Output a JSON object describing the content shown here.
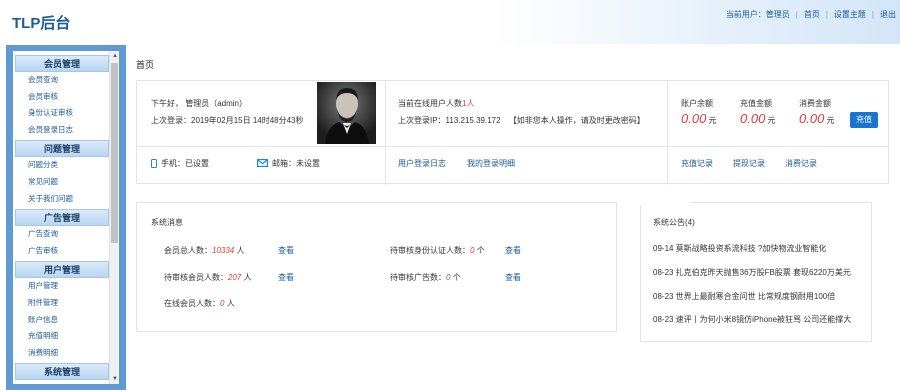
{
  "header": {
    "brand": "TLP后台",
    "current_user_label": "当前用户：管理员",
    "links": [
      "首页",
      "设置主题",
      "退出"
    ]
  },
  "sidebar": {
    "groups": [
      {
        "title": "会员管理",
        "items": [
          "会员查询",
          "会员审核",
          "身份认证审核",
          "会员登录日志"
        ]
      },
      {
        "title": "问题管理",
        "items": [
          "问题分类",
          "常见问题",
          "关于我们问题"
        ]
      },
      {
        "title": "广告管理",
        "items": [
          "广告查询",
          "广告审核"
        ]
      },
      {
        "title": "用户管理",
        "items": [
          "用户管理",
          "附件管理",
          "账户信息",
          "充值明细",
          "消费明细"
        ]
      },
      {
        "title": "系统管理",
        "items": []
      }
    ]
  },
  "breadcrumb": "首页",
  "profile": {
    "greeting": "下午好， 管理员（admin）",
    "last_login": "上次登录：2019年02月15日 14时48分43秒",
    "phone": "手机：已设置",
    "email": "邮箱：未设置"
  },
  "online": {
    "label": "当前在线用户人数",
    "count": "1人",
    "last_ip_label": "上次登录IP：113.215.39.172",
    "warning": "【如非您本人操作，请及时更改密码】",
    "link1": "用户登录日志",
    "link2": "我的登录明细"
  },
  "account": {
    "balance_label": "账户余额",
    "recharge_label": "充值金额",
    "consume_label": "消费金额",
    "balance": "0.00",
    "recharge": "0.00",
    "consume": "0.00",
    "unit": "元",
    "charge_button": "充值",
    "links": [
      "充值记录",
      "提现记录",
      "消费记录"
    ]
  },
  "system_msg": {
    "title": "系统消息",
    "members_total_label": "会员总人数：",
    "members_total": "10334",
    "members_pending_label": "待审核会员人数：",
    "members_pending": "207",
    "online_label": "在线会员人数：",
    "online": "0",
    "id_pending_label": "待审核身份认证人数：",
    "id_pending": "0",
    "ad_pending_label": "待审核广告数：",
    "ad_pending": "0",
    "unit_person": "人",
    "unit_count": "个",
    "view": "查看"
  },
  "notices": {
    "title": "系统公告(4)",
    "items": [
      "09-14 莫斯战略投资系流科技 ?加快物流业智能化",
      "08-23 扎克伯克昨天抛售36万股FB股票 套现6220万美元",
      "08-23 世界上最耐寒合金问世 比常规度钢耐用100倍",
      "08-23 速评丨为何小米8镜仿iPhone被狂骂 公司还能撑大"
    ]
  },
  "colors": {
    "accent": "#1a5a96",
    "red": "#e23b3b",
    "button": "#1876d2",
    "sidebar_frame": "#5f9ad3"
  }
}
